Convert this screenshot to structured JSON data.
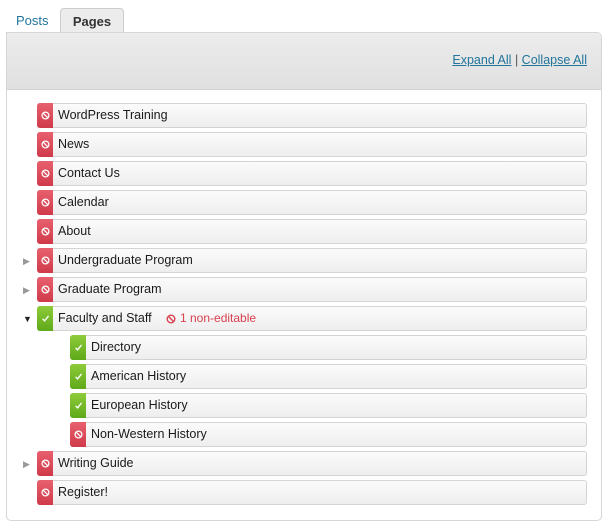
{
  "tabs": [
    {
      "label": "Posts",
      "active": false
    },
    {
      "label": "Pages",
      "active": true
    }
  ],
  "header": {
    "expand_all": "Expand All",
    "separator": "|",
    "collapse_all": "Collapse All"
  },
  "colors": {
    "non_editable": "#d8404f",
    "editable": "#6cb321",
    "link": "#21759b"
  },
  "pages": [
    {
      "label": "WordPress Training",
      "status": "non-editable",
      "level": 0,
      "toggle": "none"
    },
    {
      "label": "News",
      "status": "non-editable",
      "level": 0,
      "toggle": "none"
    },
    {
      "label": "Contact Us",
      "status": "non-editable",
      "level": 0,
      "toggle": "none"
    },
    {
      "label": "Calendar",
      "status": "non-editable",
      "level": 0,
      "toggle": "none"
    },
    {
      "label": "About",
      "status": "non-editable",
      "level": 0,
      "toggle": "none"
    },
    {
      "label": "Undergraduate Program",
      "status": "non-editable",
      "level": 0,
      "toggle": "collapsed"
    },
    {
      "label": "Graduate Program",
      "status": "non-editable",
      "level": 0,
      "toggle": "collapsed"
    },
    {
      "label": "Faculty and Staff",
      "status": "editable",
      "level": 0,
      "toggle": "expanded",
      "note": "1 non-editable"
    },
    {
      "label": "Directory",
      "status": "editable",
      "level": 1,
      "toggle": "none"
    },
    {
      "label": "American History",
      "status": "editable",
      "level": 1,
      "toggle": "none"
    },
    {
      "label": "European History",
      "status": "editable",
      "level": 1,
      "toggle": "none"
    },
    {
      "label": "Non-Western History",
      "status": "non-editable",
      "level": 1,
      "toggle": "none"
    },
    {
      "label": "Writing Guide",
      "status": "non-editable",
      "level": 0,
      "toggle": "collapsed"
    },
    {
      "label": "Register!",
      "status": "non-editable",
      "level": 0,
      "toggle": "none"
    }
  ]
}
